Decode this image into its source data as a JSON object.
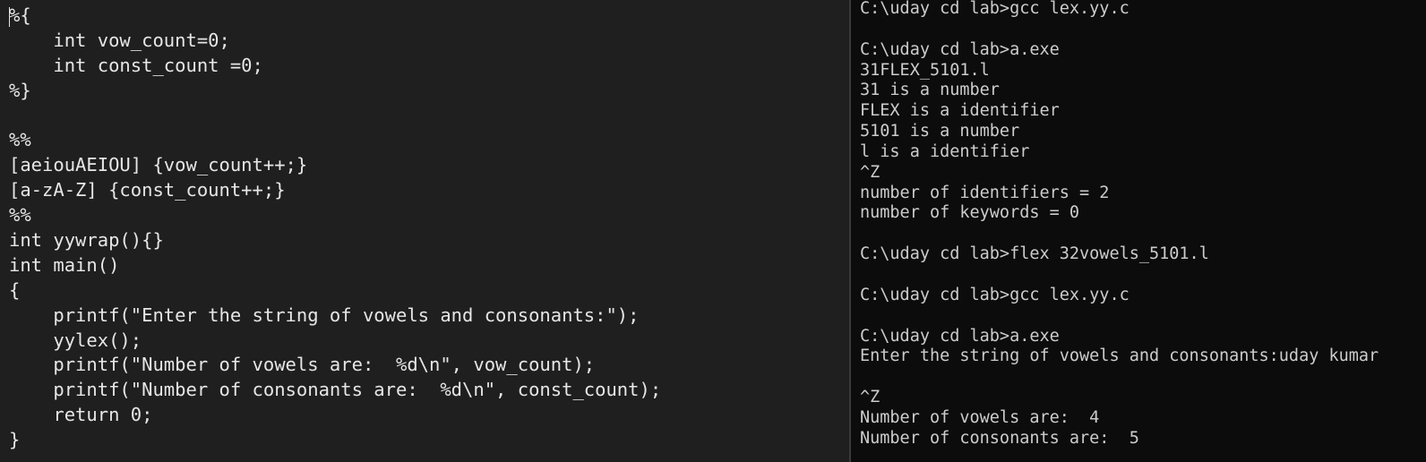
{
  "editor": {
    "lines": [
      "%{",
      "    int vow_count=0;",
      "    int const_count =0;",
      "%}",
      "",
      "%%",
      "[aeiouAEIOU] {vow_count++;}",
      "[a-zA-Z] {const_count++;}",
      "%%",
      "int yywrap(){}",
      "int main()",
      "{",
      "    printf(\"Enter the string of vowels and consonants:\");",
      "    yylex();",
      "    printf(\"Number of vowels are:  %d\\n\", vow_count);",
      "    printf(\"Number of consonants are:  %d\\n\", const_count);",
      "    return 0;",
      "}"
    ]
  },
  "terminal": {
    "lines": [
      "C:\\uday cd lab>gcc lex.yy.c",
      "",
      "C:\\uday cd lab>a.exe",
      "31FLEX_5101.l",
      "31 is a number",
      "FLEX is a identifier",
      "5101 is a number",
      "l is a identifier",
      "^Z",
      "number of identifiers = 2",
      "number of keywords = 0",
      "",
      "C:\\uday cd lab>flex 32vowels_5101.l",
      "",
      "C:\\uday cd lab>gcc lex.yy.c",
      "",
      "C:\\uday cd lab>a.exe",
      "Enter the string of vowels and consonants:uday kumar",
      "",
      "^Z",
      "Number of vowels are:  4",
      "Number of consonants are:  5"
    ]
  }
}
